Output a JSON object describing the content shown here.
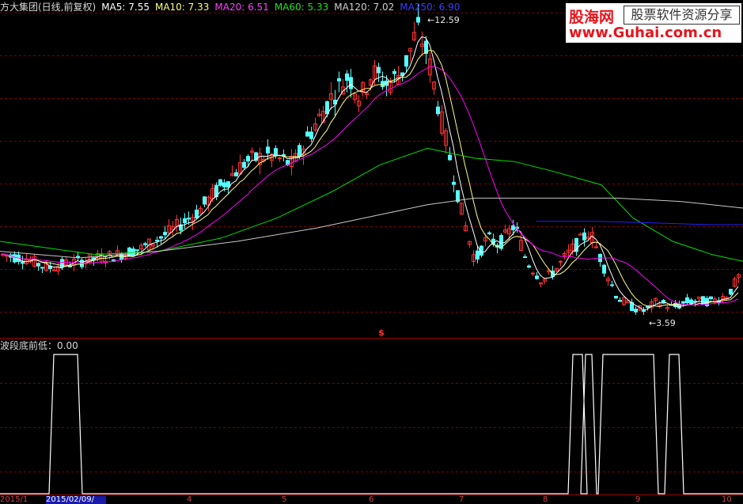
{
  "legend": {
    "name": "方大集团(日线,前复权)",
    "ma5": "MA5: 7.55",
    "ma10": "MA10: 7.33",
    "ma20": "MA20: 6.51",
    "ma60": "MA60: 5.33",
    "ma120": "MA120: 7.02",
    "ma250": "MA250: 6.90"
  },
  "sub_label": "波段底前低：0.00",
  "annotations": {
    "high": "12.59",
    "low": "3.59",
    "marker": "$"
  },
  "axis": {
    "left_text": "2015/1",
    "cursor_date": "2015/02/09/",
    "months": [
      "4",
      "5",
      "6",
      "7",
      "8",
      "9",
      "10"
    ]
  },
  "watermark": {
    "site_cn": "股海网",
    "tagline": "股票软件资源分享",
    "url": "www.Guhai.com.cn"
  },
  "colors": {
    "up": "#ff3232",
    "down": "#54ffff",
    "ma5": "#ffffff",
    "ma10": "#ffff80",
    "ma20": "#ff00ff",
    "ma60": "#00e000",
    "ma120": "#c8c8c8",
    "ma250": "#2020ff",
    "grid": "#7a0000"
  },
  "chart_data": {
    "type": "candlestick",
    "price_range": [
      3.59,
      12.59
    ],
    "high": 12.59,
    "low": 3.59,
    "ma_current": {
      "MA5": 7.55,
      "MA10": 7.33,
      "MA20": 6.51,
      "MA60": 5.33,
      "MA120": 7.02,
      "MA250": 6.9
    },
    "indicator": {
      "name": "波段底前低",
      "value": 0.0,
      "signal_windows": [
        [
          68,
          98
        ],
        [
          724,
          736
        ],
        [
          740,
          748
        ],
        [
          762,
          826
        ],
        [
          846,
          858
        ]
      ]
    }
  }
}
